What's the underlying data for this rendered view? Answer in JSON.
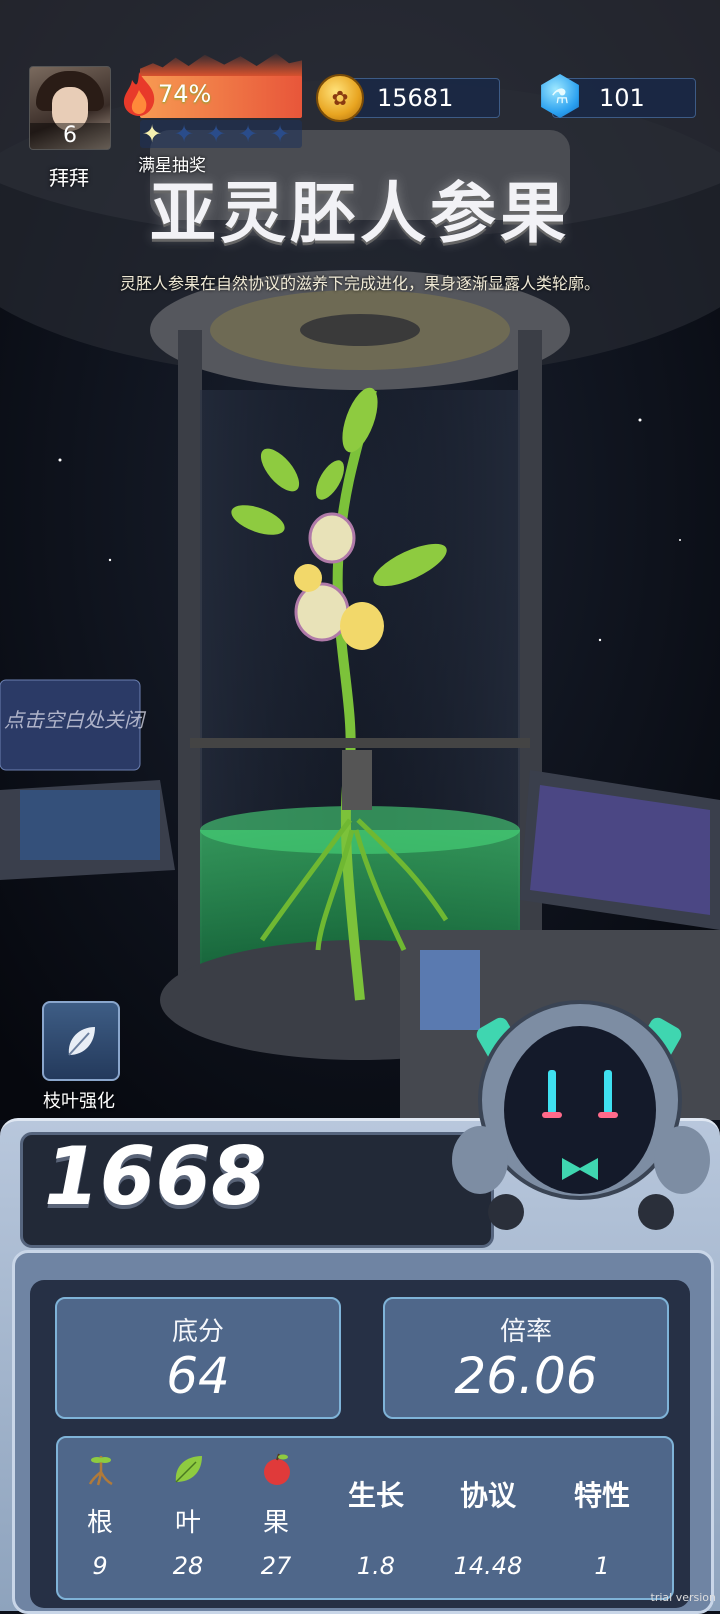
{
  "player": {
    "level": "6",
    "name": "拜拜"
  },
  "hud": {
    "fire_percent": "74%",
    "stars_filled": 1,
    "stars_total": 5,
    "stars_label": "满星抽奖",
    "coins": "15681",
    "gems": "101"
  },
  "title": "亚灵胚人参果",
  "description": "灵胚人参果在自然协议的滋养下完成进化，果身逐渐显露人类轮廓。",
  "close_hint": "点击空白处关闭",
  "leaf_button": {
    "label": "枝叶强化"
  },
  "score": "1668",
  "stats": {
    "base": {
      "label": "底分",
      "value": "64"
    },
    "multiplier": {
      "label": "倍率",
      "value": "26.06"
    }
  },
  "table": {
    "columns": [
      {
        "label": "根",
        "value": "9",
        "icon": "root-icon"
      },
      {
        "label": "叶",
        "value": "28",
        "icon": "leaf-icon"
      },
      {
        "label": "果",
        "value": "27",
        "icon": "apple-icon"
      },
      {
        "label": "生长",
        "value": "1.8"
      },
      {
        "label": "协议",
        "value": "14.48"
      },
      {
        "label": "特性",
        "value": "1"
      }
    ]
  },
  "watermark": "trial version",
  "colors": {
    "accent_blue": "#4f678a",
    "fire": "#e8563a",
    "leaf": "#7cc23a"
  }
}
